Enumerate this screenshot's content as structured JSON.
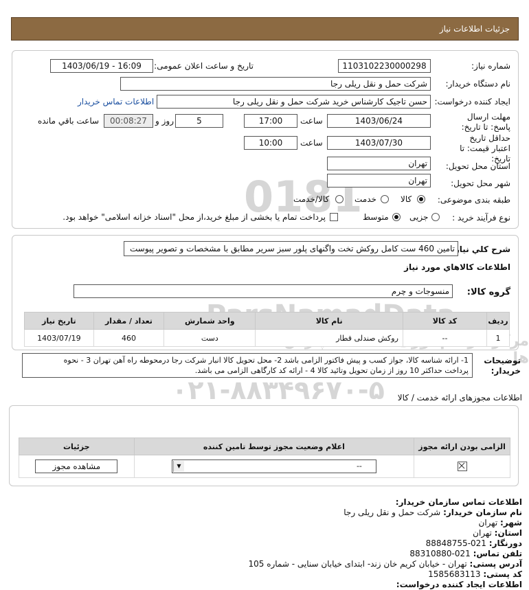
{
  "header": {
    "title": "جزئیات اطلاعات نیاز"
  },
  "form": {
    "need_number_label": "شماره نیاز:",
    "need_number_value": "1103102230000298",
    "announce_label": "تاریخ و ساعت اعلان عمومی:",
    "announce_value": "1403/06/19 - 16:09",
    "buyer_org_label": "نام دستگاه خریدار:",
    "buyer_org_value": "شرکت حمل و نقل ریلی رجا",
    "requester_label": "ایجاد کننده درخواست:",
    "requester_value": "حسن تاجیک کارشناس خرید شرکت حمل و نقل ریلی رجا",
    "contact_link": "اطلاعات تماس خریدار",
    "deadline_label": "مهلت ارسال پاسخ: تا تاریخ:",
    "deadline_date": "1403/06/24",
    "time_label": "ساعت",
    "deadline_time": "17:00",
    "days_value": "5",
    "days_and": "روز و",
    "remaining_value": "00:08:27",
    "remaining_label": "ساعت باقي مانده",
    "validity_label": "حداقل تاریخ اعتبار قیمت: تا تاریخ:",
    "validity_date": "1403/07/30",
    "validity_time": "10:00",
    "province_label": "استان محل تحویل:",
    "province_value": "تهران",
    "city_label": "شهر محل تحویل:",
    "city_value": "تهران",
    "category_label": "طبقه بندی موضوعی:",
    "category_options": [
      "کالا",
      "خدمت",
      "کالا/خدمت"
    ],
    "category_selected": "کالا",
    "process_label": "نوع فرآیند خرید :",
    "process_options": [
      "جزیی",
      "متوسط"
    ],
    "process_selected": "متوسط",
    "treasury_note": "پرداخت تمام یا بخشی از مبلغ خرید،از محل \"اسناد خزانه اسلامی\" خواهد بود."
  },
  "description": {
    "label": "شرح کلي نياز:",
    "value": "تامین 460 ست کامل روکش تخت واگنهای پلور سبز سریر مطابق با مشخصات و تصویر پیوست"
  },
  "goods_section": {
    "title": "اطلاعات کالاهاي مورد نياز",
    "group_label": "گروه کالا:",
    "group_value": "منسوجات و چرم",
    "columns": [
      "ردیف",
      "کد کالا",
      "نام کالا",
      "واحد شمارش",
      "تعداد / مقدار",
      "تاریخ نیاز"
    ],
    "rows": [
      {
        "row": "1",
        "code": "--",
        "name": "روکش صندلی قطار",
        "unit": "دست",
        "qty": "460",
        "date": "1403/07/19"
      }
    ]
  },
  "buyer_notes": {
    "label": "توضیحات خریدار:",
    "line1": "1- ارائه شناسه کالا، جواز کسب و پیش فاکتور الزامی باشد 2- محل تحویل کالا انبار شرکت رجا درمحوطه راه آهن تهران 3 - نحوه",
    "line2": "پرداخت حداکثر 10 روز از زمان تحویل وتائید کالا 4 - ارائه کد کارگاهی الزامی می باشد."
  },
  "permits": {
    "title": "اطلاعات مجوزهای ارائه خدمت / کالا",
    "columns": [
      "الزامی بودن ارائه مجوز",
      "اعلام وضعیت مجوز توسط تامین کننده",
      "جزئیات"
    ],
    "row": {
      "status_select": "--",
      "view_button": "مشاهده مجوز"
    }
  },
  "contact": {
    "title": "اطلاعات تماس سازمان خریدار:",
    "org_label": "نام سازمان خریدار:",
    "org_value": "شرکت حمل و نقل ریلی رجا",
    "city_label": "شهر:",
    "city_value": "تهران",
    "province_label": "استان:",
    "province_value": "تهران",
    "fax_label": "دورنگار:",
    "fax_value": "021-88848755",
    "phone_label": "تلفن تماس:",
    "phone_value": "021-88310880",
    "address_label": "آدرس پستی:",
    "address_value": "تهران - خیابان کریم خان زند- ابتدای خیابان سنایی - شماره 105",
    "postal_label": "کد پستی:",
    "postal_value": "1585683113",
    "creator_label": "اطلاعات ایجاد کننده درخواست:"
  },
  "watermark": {
    "number": "0181",
    "brand": "ParsNamadData",
    "persian": "مرکز فراهم آوری اطلاعات پارس نماد داده ها",
    "phone": "۰۲۱-۸۸۳۴۹۶۷۰-۵"
  },
  "colors": {
    "header_bg": "#8c6a42",
    "link": "#1a4fa0",
    "table_header": "#d9d9d9"
  }
}
